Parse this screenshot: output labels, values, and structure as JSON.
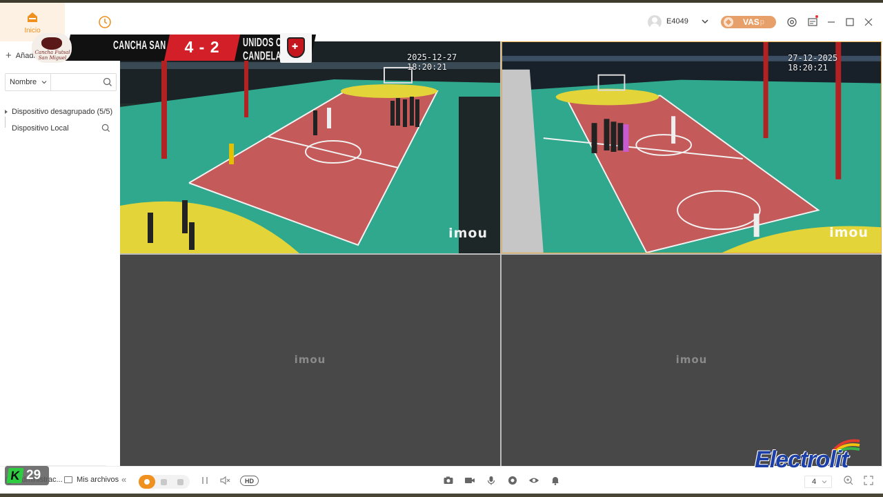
{
  "nav": {
    "home_label": "Inicio",
    "history_label": ""
  },
  "account": {
    "name": "E4049",
    "vas_label": "VAS",
    "vas_sub": "p"
  },
  "sidebar": {
    "add_label": "Añadir",
    "filter": {
      "selected": "Nombre",
      "placeholder": ""
    },
    "tree": [
      {
        "label": "Dispositivo desagrupado (5/5)"
      },
      {
        "label": "Dispositivo Local"
      }
    ]
  },
  "scoreboard": {
    "home_team": "CANCHA SAN MIGUEL",
    "away_team": "UNIDOS CON CANDELA",
    "score": "4 - 2",
    "home_logo_text": "Cancha Futsal San Miguel"
  },
  "cameras": [
    {
      "timestamp": "2025-12-27 18:20:21",
      "brand": "imou"
    },
    {
      "timestamp": "27-12-2025 18:20:21",
      "brand": "imou"
    },
    {
      "brand": "imou"
    },
    {
      "brand": "imou"
    }
  ],
  "bottombar": {
    "user_label": "Administrac...",
    "files_label": "Mis archivos",
    "hd_label": "HD",
    "split_value": "4"
  },
  "overlays": {
    "k_label": "K",
    "k_number": "29",
    "sponsor": "Electrolit"
  },
  "colors": {
    "accent": "#f0901e",
    "vas": "#e8a06a",
    "court_green": "#2fa88e",
    "court_red": "#c45a5a",
    "court_yellow": "#e3d43a",
    "score_red": "#d21f28"
  }
}
